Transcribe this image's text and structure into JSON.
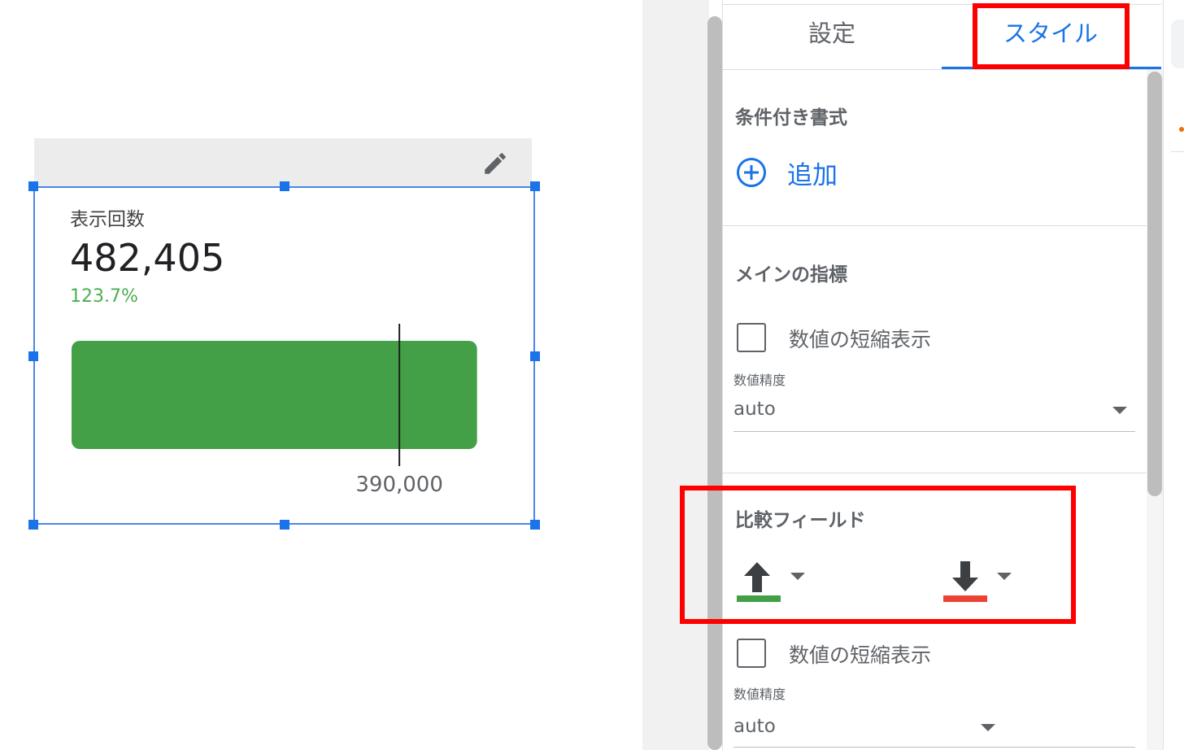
{
  "scorecard": {
    "metric_label": "表示回数",
    "metric_value": "482,405",
    "comparison_text": "123.7%",
    "comparison_color": "#4caf50",
    "icons": {
      "edit": "pencil-icon"
    }
  },
  "chart_data": {
    "type": "bar",
    "orientation": "horizontal",
    "categories": [
      "表示回数"
    ],
    "values": [
      482405
    ],
    "target": 390000,
    "target_label": "390,000",
    "xlim": [
      0,
      505000
    ],
    "bar_color": "#43a047"
  },
  "panel": {
    "tabs": [
      {
        "label": "設定",
        "active": false
      },
      {
        "label": "スタイル",
        "active": true
      }
    ],
    "conditional_format": {
      "title": "条件付き書式",
      "add_label": "追加",
      "add_icon": "add-circle-icon"
    },
    "main_metric": {
      "title": "メインの指標",
      "compact_numbers_label": "数値の短縮表示",
      "compact_numbers_checked": false,
      "precision_label": "数値精度",
      "precision_value": "auto"
    },
    "comparison_field": {
      "title": "比較フィールド",
      "positive_icon": "arrow-up-icon",
      "positive_color": "#43a047",
      "negative_icon": "arrow-down-icon",
      "negative_color": "#ea4335",
      "compact_numbers_label": "数値の短縮表示",
      "compact_numbers_checked": false,
      "precision_label": "数値精度",
      "precision_value": "auto"
    },
    "accent_color": "#1a73e8",
    "highlight_color": "#ff0000"
  }
}
